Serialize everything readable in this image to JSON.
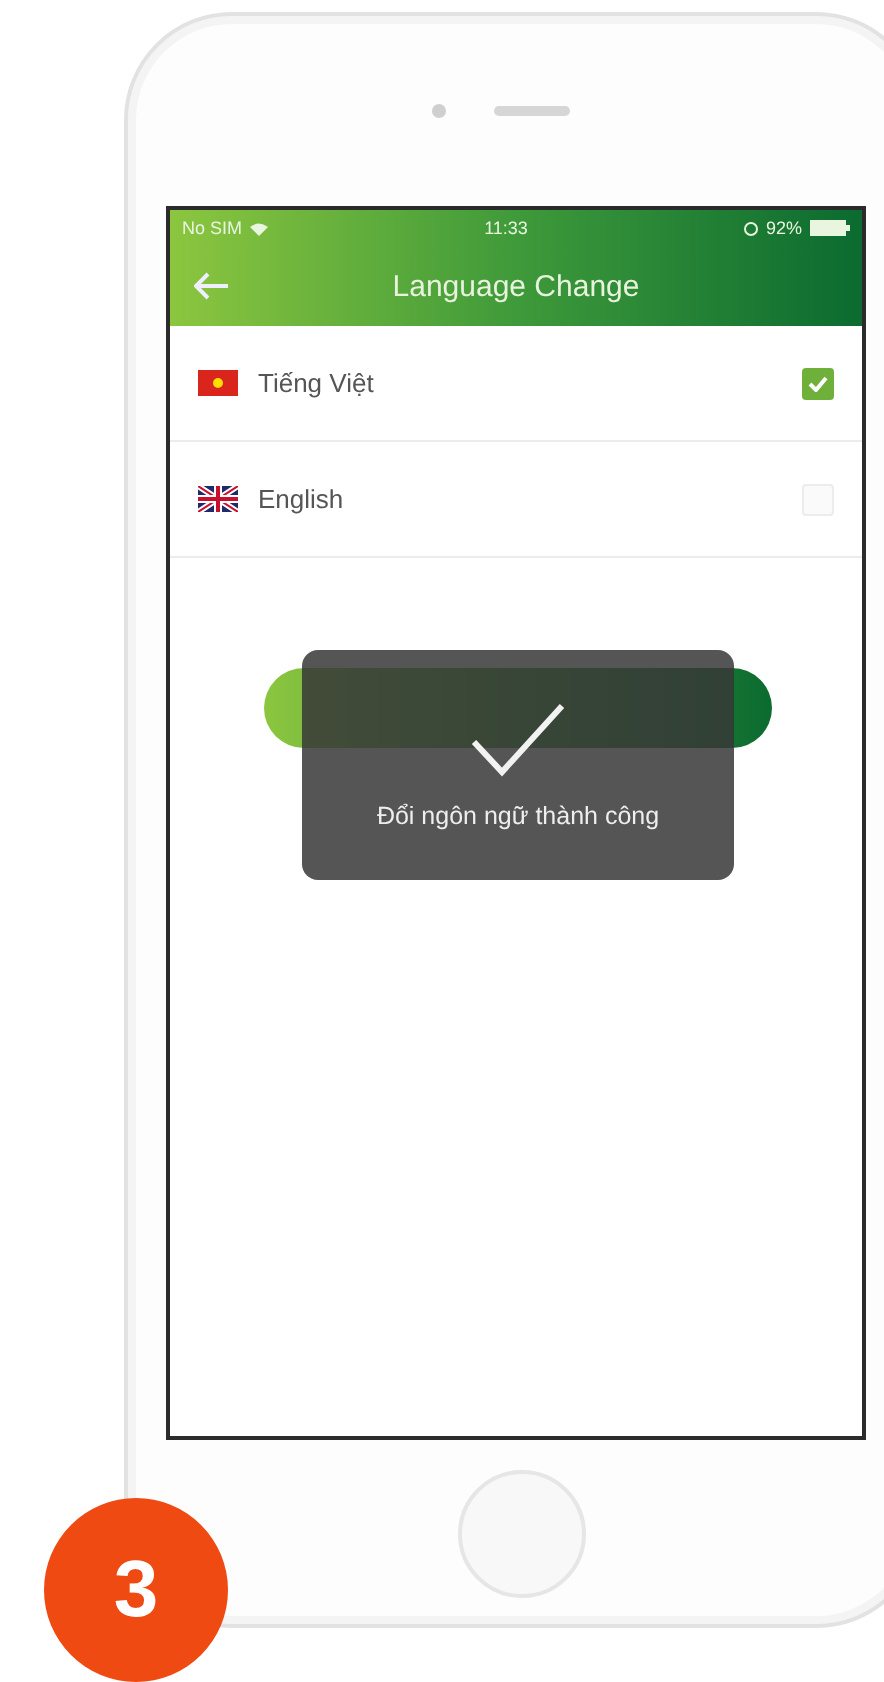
{
  "status_bar": {
    "carrier": "No SIM",
    "time": "11:33",
    "battery": "92%"
  },
  "header": {
    "title": "Language Change"
  },
  "languages": [
    {
      "label": "Tiếng Việt",
      "kind": "vn",
      "selected": true
    },
    {
      "label": "English",
      "kind": "uk",
      "selected": false
    }
  ],
  "toast": {
    "message": "Đổi ngôn ngữ thành công"
  },
  "step_badge": "3"
}
